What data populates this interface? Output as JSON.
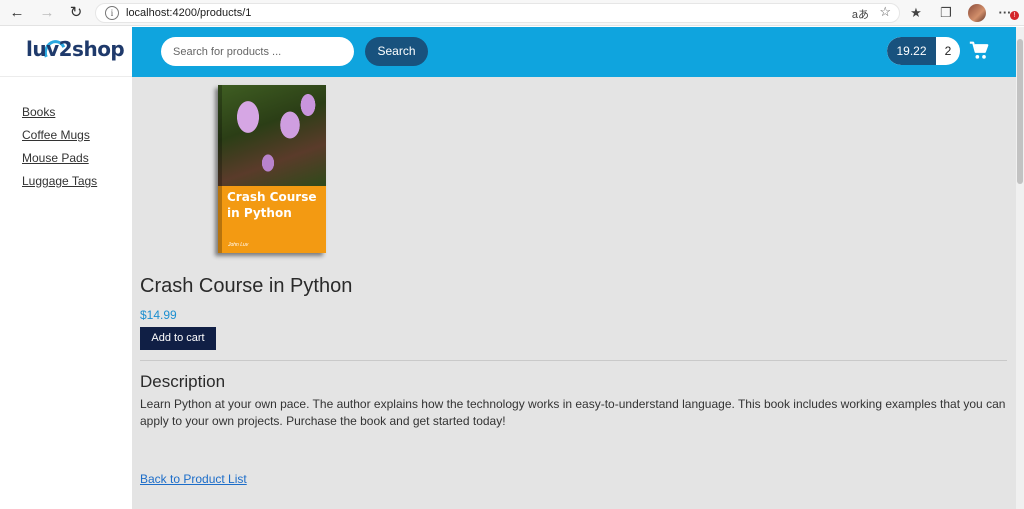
{
  "browser": {
    "url": "localhost:4200/products/1",
    "read_aloud_label": "aあ",
    "icons": [
      "back-icon",
      "forward-icon",
      "reload-icon",
      "info-icon",
      "favorite-star-icon",
      "favorites-icon",
      "collections-icon",
      "profile-avatar",
      "more-icon"
    ],
    "notification_badge": "!"
  },
  "sidebar": {
    "logo": "luv2shop",
    "categories": [
      {
        "label": "Books"
      },
      {
        "label": "Coffee Mugs"
      },
      {
        "label": "Mouse Pads"
      },
      {
        "label": "Luggage Tags"
      }
    ]
  },
  "header": {
    "search_placeholder": "Search for products ...",
    "search_button": "Search",
    "cart_total": "19.22",
    "cart_quantity": "2",
    "cart_icon": "shopping-cart-icon"
  },
  "product": {
    "cover_title": "Crash Course in Python",
    "cover_author": "John Luv",
    "name": "Crash Course in Python",
    "price": "$14.99",
    "add_to_cart": "Add to cart",
    "description_heading": "Description",
    "description": "Learn Python at your own pace. The author explains how the technology works in easy-to-understand language. This book includes working examples that you can apply to your own projects. Purchase the book and get started today!",
    "back_link": "Back to Product List"
  },
  "colors": {
    "header_bg": "#0fa4de",
    "button_dark": "#18527e",
    "add_button": "#101f45",
    "price": "#1c8fd0",
    "main_bg": "#e4e4e4"
  }
}
